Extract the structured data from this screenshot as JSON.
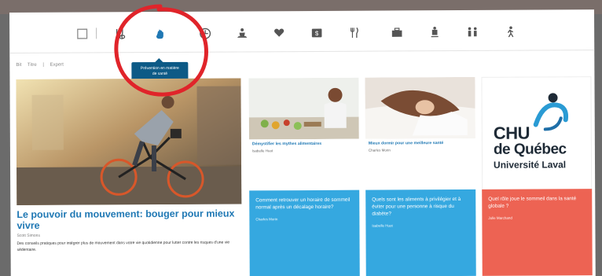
{
  "icons": [
    {
      "name": "square-outline-icon"
    },
    {
      "name": "stethoscope-icon"
    },
    {
      "name": "hand-prevention-icon"
    },
    {
      "name": "clock-icon"
    },
    {
      "name": "person-meditation-icon"
    },
    {
      "name": "heart-hands-icon"
    },
    {
      "name": "money-icon"
    },
    {
      "name": "fork-knife-icon"
    },
    {
      "name": "briefcase-icon"
    },
    {
      "name": "person-standing-icon"
    },
    {
      "name": "family-icon"
    },
    {
      "name": "walking-person-icon"
    }
  ],
  "tooltip": {
    "line1": "Prévention en matière",
    "line2": "de santé"
  },
  "filters": {
    "a": "Bit",
    "b": "Titre",
    "sep": "|",
    "c": "Expert"
  },
  "feature": {
    "title": "Le pouvoir du mouvement: bouger pour mieux vivre",
    "author": "Scott Simons",
    "description": "Des conseils pratiques pour intégrer plus de mouvement dans votre vie quotidienne pour lutter contre les risques d'une vie sédentaire."
  },
  "cards": [
    {
      "title": "Démystifier les mythes alimentaires",
      "author": "Isabelle Huot"
    },
    {
      "title": "Mieux dormir pour une meilleure santé",
      "author": "Charles Morin"
    }
  ],
  "logo": {
    "line1": "CHU",
    "line2": "de Québec",
    "line3": "Université Laval"
  },
  "tiles": [
    {
      "title": "Comment retrouver un horaire de sommeil normal après un décalage horaire?",
      "author": "Charles Morin",
      "color": "#35a8e0"
    },
    {
      "title": "Quels sont les aliments à privilégier et à éviter pour une personne à risque du diabète?",
      "author": "Isabelle Huot",
      "color": "#35a8e0"
    },
    {
      "title": "Quel rôle joue le sommeil dans la santé globale ?",
      "author": "Julie Marchand",
      "color": "#ed6353"
    }
  ],
  "colors": {
    "accent": "#1f78b4",
    "tooltip": "#0d5a86",
    "tile_blue": "#35a8e0",
    "tile_red": "#ed6353",
    "annotation": "#e0242a"
  }
}
